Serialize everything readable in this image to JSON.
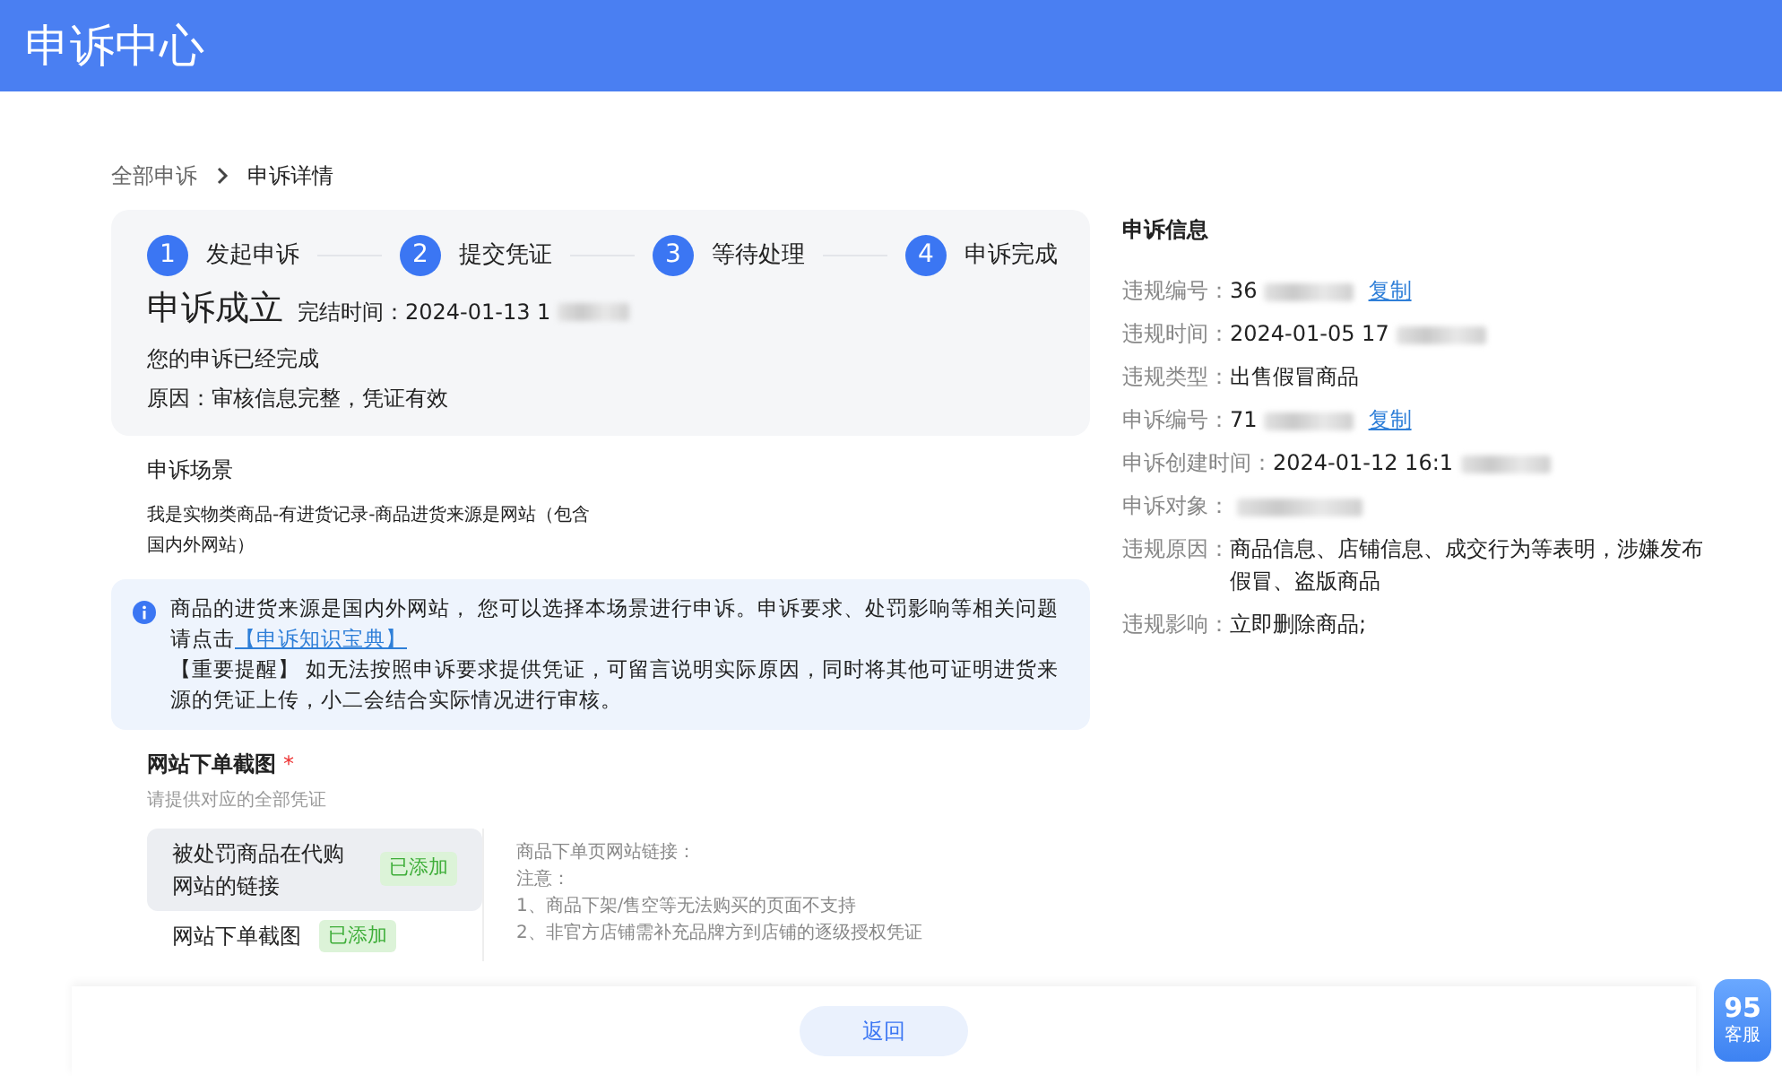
{
  "header": {
    "title": "申诉中心"
  },
  "breadcrumb": [
    {
      "label": "全部申诉",
      "current": false
    },
    {
      "label": "申诉详情",
      "current": true
    }
  ],
  "steps": [
    {
      "number": "1",
      "label": "发起申诉",
      "completed": true
    },
    {
      "number": "2",
      "label": "提交凭证",
      "completed": true
    },
    {
      "number": "3",
      "label": "等待处理",
      "completed": true
    },
    {
      "number": "4",
      "label": "申诉完成",
      "completed": true
    }
  ],
  "result": {
    "title": "申诉成立",
    "time_label": "完结时间：",
    "time_value": "2024-01-13 1",
    "time_redacted": true,
    "message": "您的申诉已经完成",
    "reason": "原因：审核信息完整，凭证有效"
  },
  "scene": {
    "title": "申诉场景",
    "text": "我是实物类商品-有进货记录-商品进货来源是网站（包含国内外网站）"
  },
  "notice": {
    "text": "商品的进货来源是国内外网站， 您可以选择本场景进行申诉。申诉要求、处罚影响等相关问题请点击",
    "link": "【申诉知识宝典】",
    "reminder": "【重要提醒】 如无法按照申诉要求提供凭证，可留言说明实际原因，同时将其他可证明进货来源的凭证上传，小二会结合实际情况进行审核。"
  },
  "evidence": {
    "title": "网站下单截图",
    "required": true,
    "required_mark": "*",
    "hint": "请提供对应的全部凭证",
    "items": [
      {
        "label": "被处罚商品在代购网站的链接",
        "status": "已添加",
        "selected": true
      },
      {
        "label": "网站下单截图",
        "status": "已添加",
        "selected": false
      }
    ],
    "details": [
      "商品下单页网站链接：",
      "注意：",
      "1、商品下架/售空等无法购买的页面不支持",
      "2、非官方店铺需补充品牌方到店铺的逐级授权凭证"
    ]
  },
  "info": {
    "title": "申诉信息",
    "rows": [
      {
        "label": "违规编号：",
        "value": "36",
        "redacted": true,
        "action": "复制"
      },
      {
        "label": "违规时间：",
        "value": "2024-01-05 17",
        "redacted": true
      },
      {
        "label": "违规类型：",
        "value": "出售假冒商品",
        "redacted": false
      },
      {
        "label": "申诉编号：",
        "value": "71",
        "redacted": true,
        "action": "复制"
      },
      {
        "label": "申诉创建时间：",
        "value": "2024-01-12 16:1",
        "redacted": true
      },
      {
        "label": "申诉对象：",
        "value": "",
        "redacted": true
      },
      {
        "label": "违规原因：",
        "value": "商品信息、店铺信息、成交行为等表明，涉嫌发布假冒、盗版商品",
        "redacted": false
      },
      {
        "label": "违规影响：",
        "value": "立即删除商品;",
        "redacted": false
      }
    ]
  },
  "footer": {
    "button": "返回"
  },
  "service": {
    "number": "95",
    "label": "客服"
  }
}
